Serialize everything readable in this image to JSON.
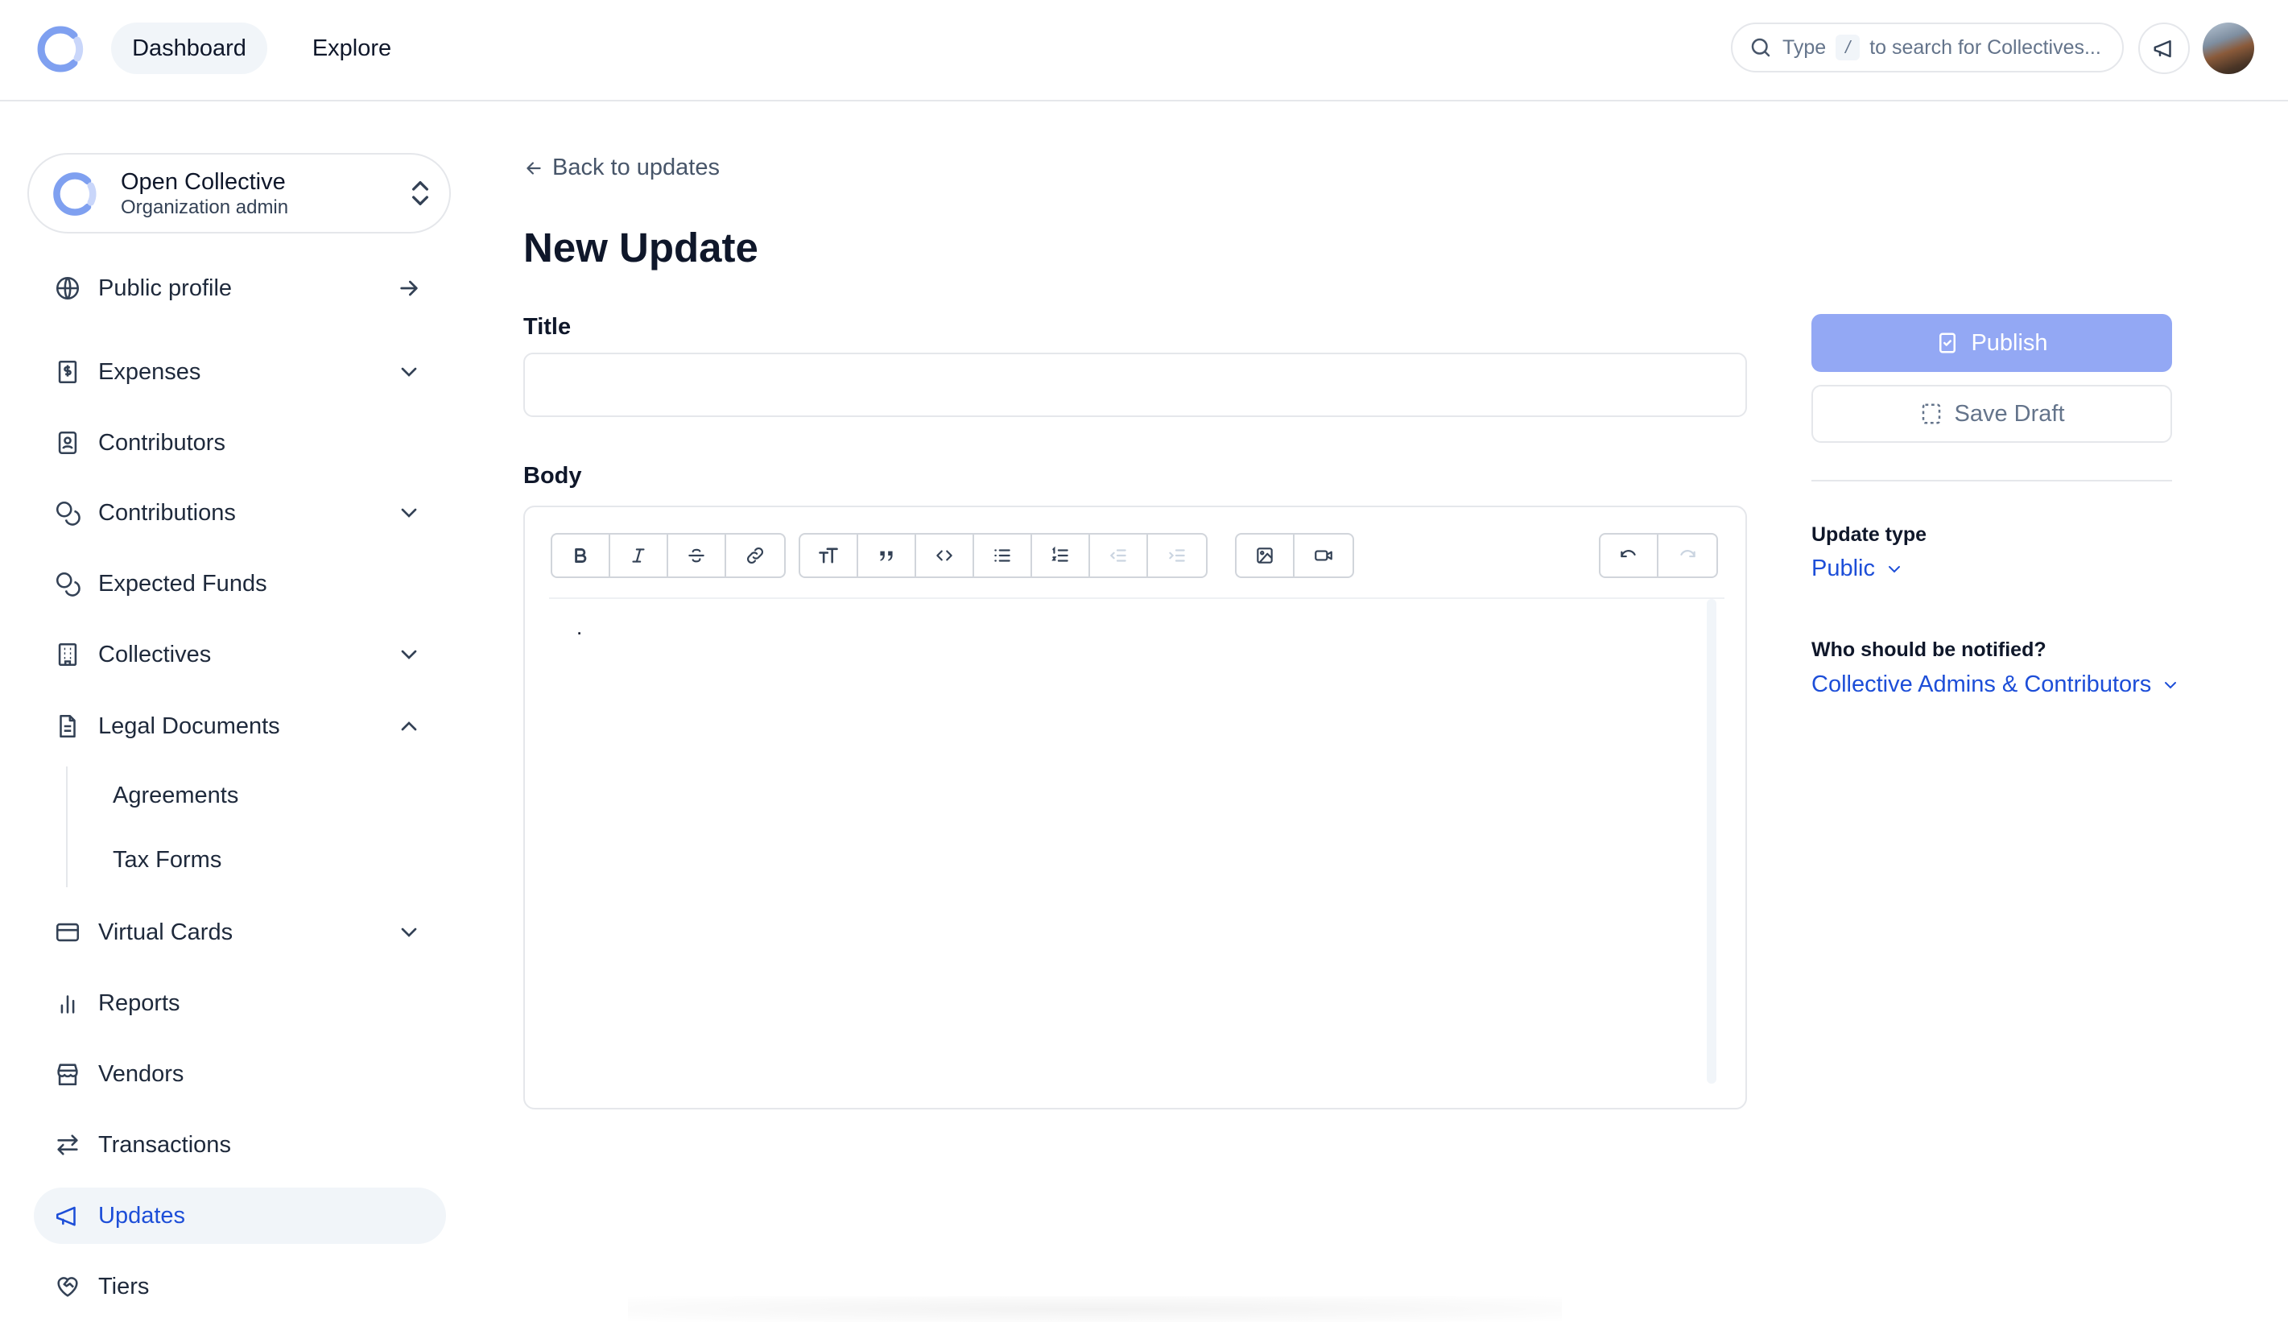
{
  "topbar": {
    "nav": [
      "Dashboard",
      "Explore"
    ],
    "search_prefix": "Type",
    "search_key": "/",
    "search_suffix": "to search for Collectives..."
  },
  "account": {
    "name": "Open Collective",
    "role": "Organization admin"
  },
  "sidebar": {
    "items": [
      {
        "label": "Public profile",
        "icon": "globe-icon",
        "trail": "arrow-right-icon"
      },
      {
        "label": "Expenses",
        "icon": "receipt-icon",
        "trail": "chevron-down-icon"
      },
      {
        "label": "Contributors",
        "icon": "contact-icon",
        "trail": ""
      },
      {
        "label": "Contributions",
        "icon": "coins-icon",
        "trail": "chevron-down-icon"
      },
      {
        "label": "Expected Funds",
        "icon": "coins-icon",
        "trail": ""
      },
      {
        "label": "Collectives",
        "icon": "building-icon",
        "trail": "chevron-down-icon"
      },
      {
        "label": "Legal Documents",
        "icon": "file-text-icon",
        "trail": "chevron-up-icon"
      },
      {
        "label": "Virtual Cards",
        "icon": "credit-card-icon",
        "trail": "chevron-down-icon"
      },
      {
        "label": "Reports",
        "icon": "bar-chart-icon",
        "trail": ""
      },
      {
        "label": "Vendors",
        "icon": "store-icon",
        "trail": ""
      },
      {
        "label": "Transactions",
        "icon": "arrow-left-right-icon",
        "trail": ""
      },
      {
        "label": "Updates",
        "icon": "megaphone-icon",
        "trail": "",
        "active": true
      },
      {
        "label": "Tiers",
        "icon": "heart-handshake-icon",
        "trail": ""
      }
    ],
    "sub_items": [
      "Agreements",
      "Tax Forms"
    ]
  },
  "main": {
    "back_link": "Back to updates",
    "title": "New Update",
    "title_label": "Title",
    "title_value": "",
    "body_label": "Body",
    "body_text": "."
  },
  "toolbar": {
    "groups": [
      [
        "bold-icon",
        "italic-icon",
        "strikethrough-icon",
        "link-icon"
      ],
      [
        "heading-icon",
        "quote-icon",
        "code-icon",
        "bullet-list-icon",
        "numbered-list-icon",
        "outdent-icon",
        "indent-icon"
      ],
      [
        "image-icon",
        "video-icon"
      ],
      [
        "undo-icon",
        "redo-icon"
      ]
    ]
  },
  "panel": {
    "publish_label": "Publish",
    "draft_label": "Save Draft",
    "update_type_label": "Update type",
    "update_type_value": "Public",
    "notify_label": "Who should be notified?",
    "notify_value": "Collective Admins & Contributors"
  },
  "colors": {
    "accent": "#1d4ed8",
    "publish_bg": "#93a8f4",
    "active_bg": "#f1f5f9",
    "border": "#e5e7eb"
  }
}
